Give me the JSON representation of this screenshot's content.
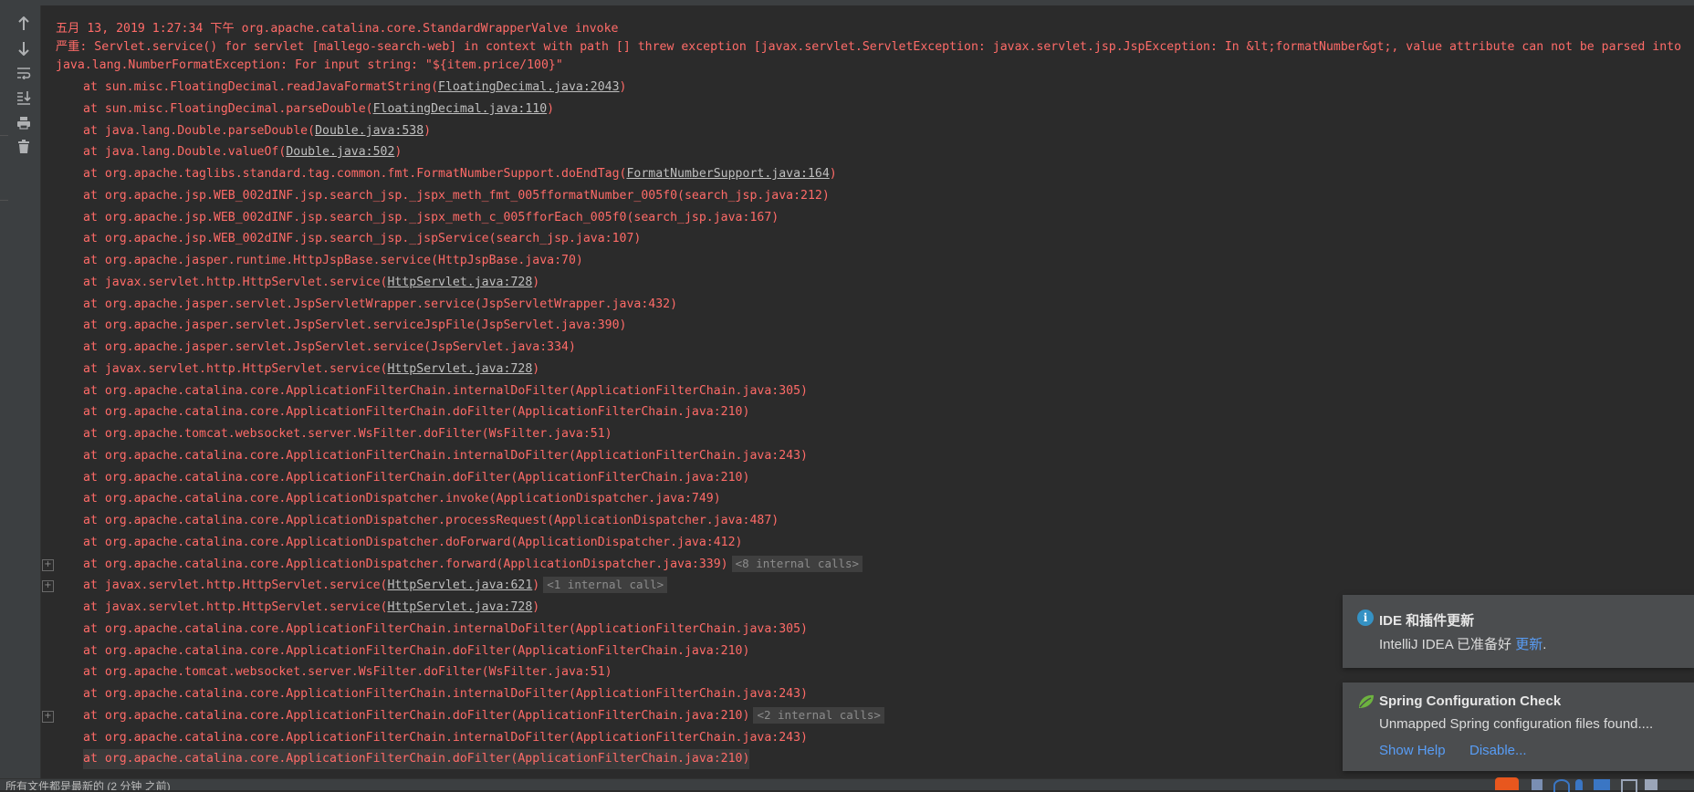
{
  "toolbar": {
    "buttons": [
      {
        "name": "up-arrow-icon"
      },
      {
        "name": "down-arrow-icon"
      },
      {
        "name": "soft-wrap-icon"
      },
      {
        "name": "scroll-to-end-icon"
      },
      {
        "name": "print-icon"
      },
      {
        "name": "trash-icon"
      }
    ]
  },
  "console": {
    "header_lines": [
      "五月 13, 2019 1:27:34 下午 org.apache.catalina.core.StandardWrapperValve invoke",
      "严重: Servlet.service() for servlet [mallego-search-web] in context with path [] threw exception [javax.servlet.ServletException: javax.servlet.jsp.JspException: In &lt;formatNumber&gt;, value attribute can not be parsed into",
      "java.lang.NumberFormatException: For input string: \"${item.price/100}\""
    ],
    "stack": [
      {
        "text": "at sun.misc.FloatingDecimal.readJavaFormatString(",
        "link": "FloatingDecimal.java:2043",
        "suffix": ")"
      },
      {
        "text": "at sun.misc.FloatingDecimal.parseDouble(",
        "link": "FloatingDecimal.java:110",
        "suffix": ")"
      },
      {
        "text": "at java.lang.Double.parseDouble(",
        "link": "Double.java:538",
        "suffix": ")"
      },
      {
        "text": "at java.lang.Double.valueOf(",
        "link": "Double.java:502",
        "suffix": ")"
      },
      {
        "text": "at org.apache.taglibs.standard.tag.common.fmt.FormatNumberSupport.doEndTag(",
        "link": "FormatNumberSupport.java:164",
        "suffix": ")"
      },
      {
        "text": "at org.apache.jsp.WEB_002dINF.jsp.search_jsp._jspx_meth_fmt_005fformatNumber_005f0(search_jsp.java:212)"
      },
      {
        "text": "at org.apache.jsp.WEB_002dINF.jsp.search_jsp._jspx_meth_c_005fforEach_005f0(search_jsp.java:167)"
      },
      {
        "text": "at org.apache.jsp.WEB_002dINF.jsp.search_jsp._jspService(search_jsp.java:107)"
      },
      {
        "text": "at org.apache.jasper.runtime.HttpJspBase.service(HttpJspBase.java:70)"
      },
      {
        "text": "at javax.servlet.http.HttpServlet.service(",
        "link": "HttpServlet.java:728",
        "suffix": ")"
      },
      {
        "text": "at org.apache.jasper.servlet.JspServletWrapper.service(JspServletWrapper.java:432)"
      },
      {
        "text": "at org.apache.jasper.servlet.JspServlet.serviceJspFile(JspServlet.java:390)"
      },
      {
        "text": "at org.apache.jasper.servlet.JspServlet.service(JspServlet.java:334)"
      },
      {
        "text": "at javax.servlet.http.HttpServlet.service(",
        "link": "HttpServlet.java:728",
        "suffix": ")"
      },
      {
        "text": "at org.apache.catalina.core.ApplicationFilterChain.internalDoFilter(ApplicationFilterChain.java:305)"
      },
      {
        "text": "at org.apache.catalina.core.ApplicationFilterChain.doFilter(ApplicationFilterChain.java:210)"
      },
      {
        "text": "at org.apache.tomcat.websocket.server.WsFilter.doFilter(WsFilter.java:51)"
      },
      {
        "text": "at org.apache.catalina.core.ApplicationFilterChain.internalDoFilter(ApplicationFilterChain.java:243)"
      },
      {
        "text": "at org.apache.catalina.core.ApplicationFilterChain.doFilter(ApplicationFilterChain.java:210)"
      },
      {
        "text": "at org.apache.catalina.core.ApplicationDispatcher.invoke(ApplicationDispatcher.java:749)"
      },
      {
        "text": "at org.apache.catalina.core.ApplicationDispatcher.processRequest(ApplicationDispatcher.java:487)"
      },
      {
        "text": "at org.apache.catalina.core.ApplicationDispatcher.doForward(ApplicationDispatcher.java:412)"
      },
      {
        "text": "at org.apache.catalina.core.ApplicationDispatcher.forward(ApplicationDispatcher.java:339)",
        "fold": "<8 internal calls>"
      },
      {
        "text": "at javax.servlet.http.HttpServlet.service(",
        "link": "HttpServlet.java:621",
        "suffix": ")",
        "fold": "<1 internal call>"
      },
      {
        "text": "at javax.servlet.http.HttpServlet.service(",
        "link": "HttpServlet.java:728",
        "suffix": ")"
      },
      {
        "text": "at org.apache.catalina.core.ApplicationFilterChain.internalDoFilter(ApplicationFilterChain.java:305)"
      },
      {
        "text": "at org.apache.catalina.core.ApplicationFilterChain.doFilter(ApplicationFilterChain.java:210)"
      },
      {
        "text": "at org.apache.tomcat.websocket.server.WsFilter.doFilter(WsFilter.java:51)"
      },
      {
        "text": "at org.apache.catalina.core.ApplicationFilterChain.internalDoFilter(ApplicationFilterChain.java:243)"
      },
      {
        "text": "at org.apache.catalina.core.ApplicationFilterChain.doFilter(ApplicationFilterChain.java:210)",
        "fold": "<2 internal calls>"
      },
      {
        "text": "at org.apache.catalina.core.ApplicationFilterChain.internalDoFilter(ApplicationFilterChain.java:243)"
      },
      {
        "text": "at org.apache.catalina.core.ApplicationFilterChain.doFilter(ApplicationFilterChain.java:210)"
      }
    ]
  },
  "notifications": {
    "update": {
      "title": "IDE 和插件更新",
      "message": "IntelliJ IDEA 已准备好",
      "link": "更新",
      "trailing": "."
    },
    "spring": {
      "title": "Spring Configuration Check",
      "message": "Unmapped Spring configuration files found....",
      "show_help": "Show Help",
      "disable": "Disable..."
    }
  },
  "status_bar": {
    "text": "所有文件都是最新的 (2 分钟 之前)"
  },
  "colors": {
    "error_text": "#ff6b68",
    "link_text": "#bfbfbf",
    "console_bg": "#2b2b2b",
    "notification_link": "#589df6"
  }
}
